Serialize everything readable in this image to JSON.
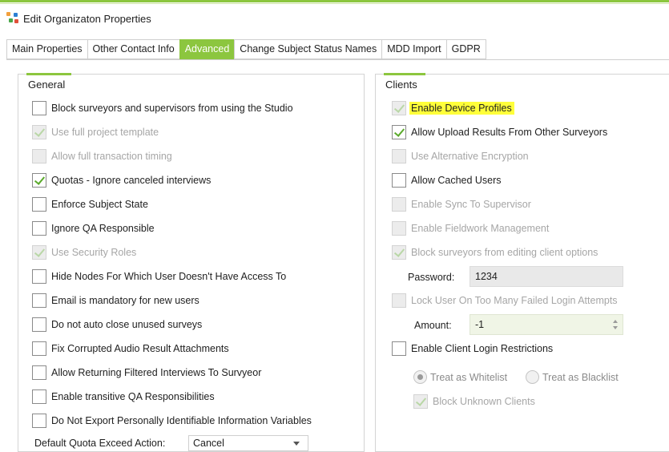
{
  "window": {
    "title": "Edit Organizaton Properties"
  },
  "tabs": [
    {
      "label": "Main Properties",
      "active": false
    },
    {
      "label": "Other Contact Info",
      "active": false
    },
    {
      "label": "Advanced",
      "active": true
    },
    {
      "label": "Change Subject Status Names",
      "active": false
    },
    {
      "label": "MDD Import",
      "active": false
    },
    {
      "label": "GDPR",
      "active": false
    }
  ],
  "general": {
    "title": "General",
    "items": [
      {
        "label": "Block surveyors and supervisors from using the Studio",
        "checked": false,
        "disabled": false
      },
      {
        "label": "Use full project template",
        "checked": true,
        "disabled": true
      },
      {
        "label": "Allow full transaction timing",
        "checked": false,
        "disabled": true
      },
      {
        "label": "Quotas - Ignore canceled interviews",
        "checked": true,
        "disabled": false
      },
      {
        "label": "Enforce Subject State",
        "checked": false,
        "disabled": false
      },
      {
        "label": "Ignore QA Responsible",
        "checked": false,
        "disabled": false
      },
      {
        "label": "Use Security Roles",
        "checked": true,
        "disabled": true
      },
      {
        "label": "Hide Nodes For Which User Doesn't Have Access To",
        "checked": false,
        "disabled": false
      },
      {
        "label": "Email is mandatory for new users",
        "checked": false,
        "disabled": false
      },
      {
        "label": "Do not auto close unused surveys",
        "checked": false,
        "disabled": false
      },
      {
        "label": "Fix Corrupted Audio Result Attachments",
        "checked": false,
        "disabled": false
      },
      {
        "label": "Allow Returning Filtered Interviews To Survyeor",
        "checked": false,
        "disabled": false
      },
      {
        "label": "Enable transitive QA Responsibilities",
        "checked": false,
        "disabled": false
      },
      {
        "label": "Do Not Export Personally Identifiable Information Variables",
        "checked": false,
        "disabled": false
      }
    ],
    "quota_action_label": "Default Quota Exceed Action:",
    "quota_action_value": "Cancel"
  },
  "clients": {
    "title": "Clients",
    "items": [
      {
        "label": "Enable Device Profiles",
        "checked": true,
        "disabled": true,
        "highlight": "#ffff3a"
      },
      {
        "label": "Allow Upload Results From Other Surveyors",
        "checked": true,
        "disabled": false
      },
      {
        "label": "Use Alternative Encryption",
        "checked": false,
        "disabled": true
      },
      {
        "label": "Allow Cached Users",
        "checked": false,
        "disabled": false
      },
      {
        "label": "Enable Sync To Supervisor",
        "checked": false,
        "disabled": true
      },
      {
        "label": "Enable Fieldwork Management",
        "checked": false,
        "disabled": true
      },
      {
        "label": "Block surveyors from editing client options",
        "checked": true,
        "disabled": true
      }
    ],
    "password_label": "Password:",
    "password_value": "1234",
    "lock_label": "Lock User On Too Many Failed Login Attempts",
    "amount_label": "Amount:",
    "amount_value": "-1",
    "login_restrictions_label": "Enable Client Login Restrictions",
    "whitelist_label": "Treat as Whitelist",
    "blacklist_label": "Treat as Blacklist",
    "selected_mode": "Treat as Whitelist",
    "block_unknown_label": "Block Unknown Clients"
  },
  "colors": {
    "accent": "#8cc63f",
    "highlight": "#ffff3a",
    "check": "#5aaa2a"
  }
}
